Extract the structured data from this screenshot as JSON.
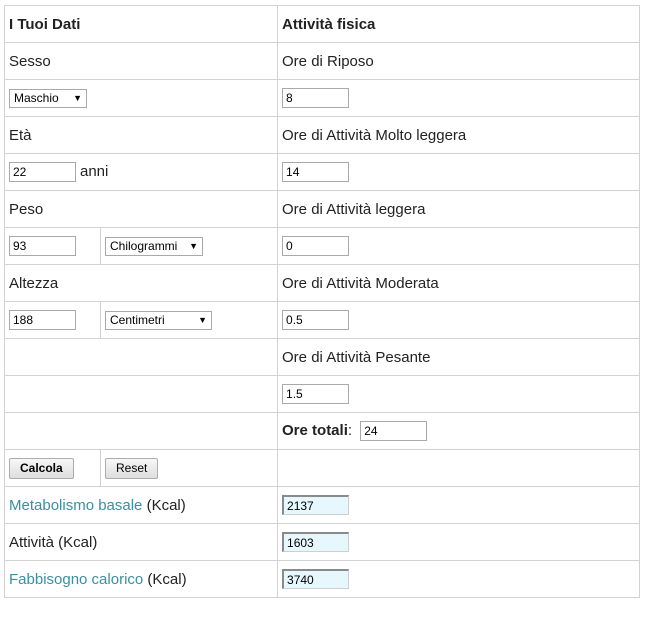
{
  "headers": {
    "left": "I Tuoi Dati",
    "right": "Attività fisica"
  },
  "sesso": {
    "label": "Sesso",
    "value": "Maschio"
  },
  "eta": {
    "label": "Età",
    "value": "22",
    "unit": "anni"
  },
  "peso": {
    "label": "Peso",
    "value": "93",
    "unit": "Chilogrammi"
  },
  "altezza": {
    "label": "Altezza",
    "value": "188",
    "unit": "Centimetri"
  },
  "activity": {
    "riposo": {
      "label": "Ore di Riposo",
      "value": "8"
    },
    "molto_leggera": {
      "label": "Ore di Attività Molto leggera",
      "value": "14"
    },
    "leggera": {
      "label": "Ore di Attività leggera",
      "value": "0"
    },
    "moderata": {
      "label": "Ore di Attività Moderata",
      "value": "0.5"
    },
    "pesante": {
      "label": "Ore di Attività Pesante",
      "value": "1.5"
    },
    "totali": {
      "label": "Ore totali",
      "suffix": ":",
      "value": "24"
    }
  },
  "buttons": {
    "calcola": "Calcola",
    "reset": "Reset"
  },
  "results": {
    "metabolismo": {
      "link": "Metabolismo basale",
      "unit": " (Kcal)",
      "value": "2137"
    },
    "attivita": {
      "label": "Attività (Kcal)",
      "value": "1603"
    },
    "fabbisogno": {
      "link": "Fabbisogno calorico",
      "unit": " (Kcal)",
      "value": "3740"
    }
  },
  "colors": {
    "link": "#3a8fa0",
    "result_bg": "#e6f7fd",
    "border": "#d2d2d2"
  }
}
